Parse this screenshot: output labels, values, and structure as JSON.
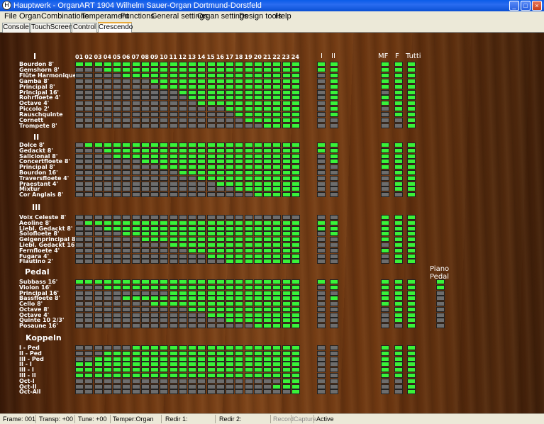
{
  "window": {
    "title": "Hauptwerk - OrganART 1904 Wilhelm Sauer-Organ Dortmund-Dorstfeld",
    "buttons": [
      "_",
      "□",
      "×"
    ]
  },
  "menu": [
    "File",
    "Organ",
    "Combinations",
    "Temperament",
    "Functions",
    "General settings",
    "Organ settings",
    "Design tools",
    "Help"
  ],
  "tabs": [
    "Console",
    "TouchScreen",
    "Control",
    "Crescendo"
  ],
  "active_tab": "Crescendo",
  "columns": [
    "01",
    "02",
    "03",
    "04",
    "05",
    "06",
    "07",
    "08",
    "09",
    "10",
    "11",
    "12",
    "13",
    "14",
    "15",
    "16",
    "17",
    "18",
    "19",
    "20",
    "21",
    "22",
    "23",
    "24"
  ],
  "col_headers": {
    "i": "I",
    "ii": "II",
    "mf": "MF",
    "f": "F",
    "tutti": "Tutti"
  },
  "sections": [
    {
      "name": "I",
      "rows": [
        {
          "label": "Bourdon 8'",
          "start": 1,
          "i": 1,
          "ii": 1,
          "mf": 1,
          "f": 1,
          "tutti": 1
        },
        {
          "label": "Gemshorn 8'",
          "start": 4,
          "i": 1,
          "ii": 1,
          "mf": 1,
          "f": 1,
          "tutti": 1
        },
        {
          "label": "Flûte Harmonique 8'",
          "start": 6,
          "i": 0,
          "ii": 1,
          "mf": 1,
          "f": 1,
          "tutti": 1
        },
        {
          "label": "Gamba 8'",
          "start": 9,
          "i": 0,
          "ii": 1,
          "mf": 1,
          "f": 1,
          "tutti": 1
        },
        {
          "label": "Principal 8'",
          "start": 10,
          "i": 0,
          "ii": 1,
          "mf": 1,
          "f": 1,
          "tutti": 1
        },
        {
          "label": "Principal 16'",
          "start": 12,
          "i": 0,
          "ii": 1,
          "mf": 0,
          "f": 1,
          "tutti": 1
        },
        {
          "label": "Rohrfloete 4'",
          "start": 13,
          "i": 0,
          "ii": 1,
          "mf": 1,
          "f": 1,
          "tutti": 1
        },
        {
          "label": "Octave 4'",
          "start": 14,
          "i": 0,
          "ii": 1,
          "mf": 1,
          "f": 1,
          "tutti": 1
        },
        {
          "label": "Piccolo 2'",
          "start": 17,
          "i": 0,
          "ii": 1,
          "mf": 0,
          "f": 1,
          "tutti": 1
        },
        {
          "label": "Rauschquinte",
          "start": 18,
          "i": 0,
          "ii": 1,
          "mf": 0,
          "f": 1,
          "tutti": 1
        },
        {
          "label": "Cornett",
          "start": 19,
          "i": 0,
          "ii": 0,
          "mf": 0,
          "f": 0,
          "tutti": 1
        },
        {
          "label": "Trompete 8'",
          "start": 21,
          "i": 0,
          "ii": 0,
          "mf": 0,
          "f": 0,
          "tutti": 1
        }
      ]
    },
    {
      "name": "II",
      "rows": [
        {
          "label": "Dolce 8'",
          "start": 2,
          "i": 1,
          "ii": 1,
          "mf": 1,
          "f": 1,
          "tutti": 1
        },
        {
          "label": "Gedackt 8'",
          "start": 4,
          "i": 1,
          "ii": 1,
          "mf": 1,
          "f": 1,
          "tutti": 1
        },
        {
          "label": "Salicional 8'",
          "start": 5,
          "i": 0,
          "ii": 1,
          "mf": 1,
          "f": 1,
          "tutti": 1
        },
        {
          "label": "Concertfloete 8'",
          "start": 8,
          "i": 0,
          "ii": 1,
          "mf": 1,
          "f": 1,
          "tutti": 1
        },
        {
          "label": "Principal 8'",
          "start": 10,
          "i": 0,
          "ii": 0,
          "mf": 1,
          "f": 1,
          "tutti": 1
        },
        {
          "label": "Bourdon 16'",
          "start": 12,
          "i": 0,
          "ii": 0,
          "mf": 0,
          "f": 1,
          "tutti": 1
        },
        {
          "label": "Traversfloete 4'",
          "start": 14,
          "i": 0,
          "ii": 0,
          "mf": 0,
          "f": 1,
          "tutti": 1
        },
        {
          "label": "Praestant 4'",
          "start": 16,
          "i": 0,
          "ii": 0,
          "mf": 0,
          "f": 1,
          "tutti": 1
        },
        {
          "label": "Mixtur",
          "start": 18,
          "i": 0,
          "ii": 0,
          "mf": 0,
          "f": 1,
          "tutti": 1
        },
        {
          "label": "Cor Anglais 8'",
          "start": 20,
          "i": 0,
          "ii": 0,
          "mf": 0,
          "f": 0,
          "tutti": 1
        }
      ]
    },
    {
      "name": "III",
      "rows": [
        {
          "label": "Voix Celeste 8'",
          "start": 25,
          "i": 0,
          "ii": 0,
          "mf": 1,
          "f": 1,
          "tutti": 1
        },
        {
          "label": "Aeoline 8'",
          "start": 2,
          "i": 1,
          "ii": 1,
          "mf": 1,
          "f": 1,
          "tutti": 1
        },
        {
          "label": "Liebl. Gedackt 8'",
          "start": 4,
          "i": 1,
          "ii": 1,
          "mf": 1,
          "f": 1,
          "tutti": 1
        },
        {
          "label": "Solofloete 8'",
          "start": 6,
          "i": 0,
          "ii": 1,
          "mf": 1,
          "f": 1,
          "tutti": 1
        },
        {
          "label": "Geigenprincipal 8'",
          "start": 8,
          "i": 0,
          "ii": 0,
          "mf": 1,
          "f": 1,
          "tutti": 1
        },
        {
          "label": "Liebl. Gedackt 16'",
          "start": 11,
          "i": 0,
          "ii": 0,
          "mf": 0,
          "f": 1,
          "tutti": 1
        },
        {
          "label": "Fernfloete 4'",
          "start": 13,
          "i": 0,
          "ii": 0,
          "mf": 1,
          "f": 1,
          "tutti": 1
        },
        {
          "label": "Fugara 4'",
          "start": 15,
          "i": 0,
          "ii": 0,
          "mf": 0,
          "f": 1,
          "tutti": 1
        },
        {
          "label": "Flautino 2'",
          "start": 17,
          "i": 0,
          "ii": 0,
          "mf": 0,
          "f": 1,
          "tutti": 1
        }
      ]
    },
    {
      "name": "Pedal",
      "rows": [
        {
          "label": "Subbass 16'",
          "start": 1,
          "i": 1,
          "ii": 1,
          "mf": 1,
          "f": 1,
          "tutti": 1,
          "pp": 1
        },
        {
          "label": "Violon 16'",
          "start": 4,
          "i": 0,
          "ii": 1,
          "mf": 1,
          "f": 1,
          "tutti": 1,
          "pp": 1
        },
        {
          "label": "Principal 16'",
          "start": 11,
          "i": 0,
          "ii": 0,
          "mf": 1,
          "f": 1,
          "tutti": 1,
          "pp": 0
        },
        {
          "label": "Bassfloete 8'",
          "start": 6,
          "i": 0,
          "ii": 1,
          "mf": 1,
          "f": 1,
          "tutti": 1,
          "pp": 0
        },
        {
          "label": "Cello 8'",
          "start": 9,
          "i": 0,
          "ii": 0,
          "mf": 1,
          "f": 1,
          "tutti": 1,
          "pp": 0
        },
        {
          "label": "Octave 8'",
          "start": 13,
          "i": 0,
          "ii": 0,
          "mf": 0,
          "f": 1,
          "tutti": 1,
          "pp": 0
        },
        {
          "label": "Octave 4'",
          "start": 15,
          "i": 0,
          "ii": 0,
          "mf": 0,
          "f": 1,
          "tutti": 1,
          "pp": 0
        },
        {
          "label": "Quinte 10 2/3'",
          "start": 17,
          "i": 0,
          "ii": 0,
          "mf": 0,
          "f": 1,
          "tutti": 1,
          "pp": 0
        },
        {
          "label": "Posaune 16'",
          "start": 20,
          "i": 0,
          "ii": 0,
          "mf": 0,
          "f": 0,
          "tutti": 1,
          "pp": 0
        }
      ]
    },
    {
      "name": "Koppeln",
      "rows": [
        {
          "label": "I - Ped",
          "start": 7,
          "i": 0,
          "ii": 0,
          "mf": 1,
          "f": 1,
          "tutti": 1
        },
        {
          "label": "II - Ped",
          "start": 4,
          "i": 0,
          "ii": 0,
          "mf": 1,
          "f": 1,
          "tutti": 1
        },
        {
          "label": "III - Ped",
          "start": 3,
          "i": 0,
          "ii": 0,
          "mf": 1,
          "f": 1,
          "tutti": 1
        },
        {
          "label": "II - I",
          "start": 1,
          "i": 0,
          "ii": 0,
          "mf": 1,
          "f": 1,
          "tutti": 1
        },
        {
          "label": "III - I",
          "start": 1,
          "i": 0,
          "ii": 0,
          "mf": 1,
          "f": 1,
          "tutti": 1
        },
        {
          "label": "III - II",
          "start": 1,
          "i": 0,
          "ii": 0,
          "mf": 1,
          "f": 1,
          "tutti": 1
        },
        {
          "label": "Oct-I",
          "start": 23,
          "i": 0,
          "ii": 0,
          "mf": 0,
          "f": 0,
          "tutti": 1
        },
        {
          "label": "Oct-II",
          "start": 22,
          "i": 0,
          "ii": 0,
          "mf": 0,
          "f": 0,
          "tutti": 1
        },
        {
          "label": "Oct-All",
          "start": 24,
          "i": 0,
          "ii": 0,
          "mf": 0,
          "f": 0,
          "tutti": 1
        }
      ]
    }
  ],
  "piano_pedal": {
    "label1": "Piano",
    "label2": "Pedal"
  },
  "status": {
    "frame": "Frame: 001",
    "transp": "Transp: +00",
    "tune": "Tune: +00",
    "temper": "Temper:Organ",
    "redir1": "Redir 1:",
    "redir2": "Redir 2:",
    "record": "Record",
    "capture": "Capture",
    "active": "Active"
  },
  "colors": {
    "on": "#39f239",
    "off": "#6d6d6d"
  }
}
